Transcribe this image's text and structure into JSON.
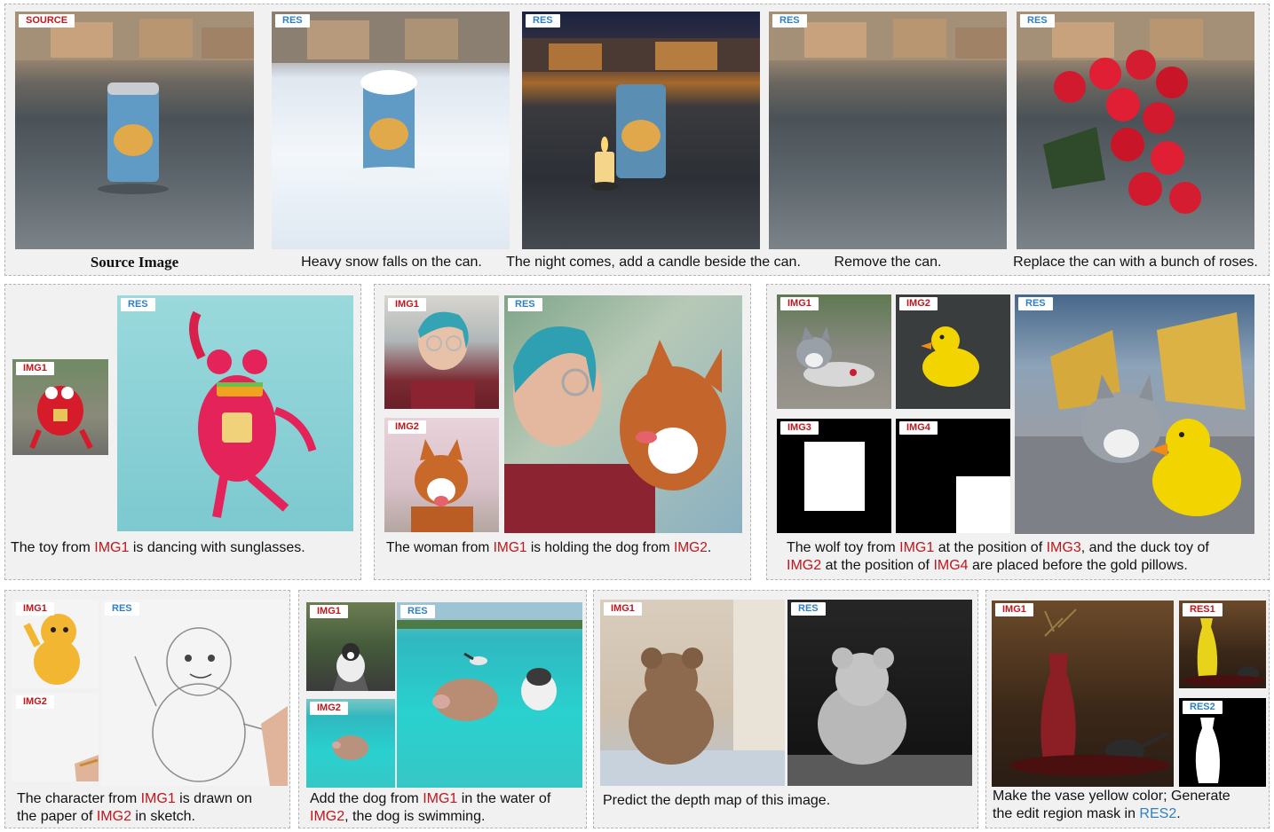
{
  "tags": {
    "source": "SOURCE",
    "res": "RES",
    "res1": "RES1",
    "res2": "RES2",
    "img1": "IMG1",
    "img2": "IMG2",
    "img3": "IMG3",
    "img4": "IMG4"
  },
  "row1": {
    "source_caption": "Source Image",
    "captions": [
      "Heavy snow falls on the can.",
      "The night comes, add a candle beside the can.",
      "Remove the can.",
      "Replace the can with a bunch of roses."
    ]
  },
  "row2": {
    "toy": {
      "pre": "The toy from ",
      "ref1": "IMG1",
      "post": " is dancing with sunglasses."
    },
    "woman": {
      "pre": "The woman from ",
      "ref1": "IMG1",
      "mid": " is holding the dog from ",
      "ref2": "IMG2",
      "post": "."
    },
    "wolf": {
      "l1_pre": "The wolf toy from ",
      "l1_ref1": "IMG1",
      "l1_mid": " at the position of ",
      "l1_ref2": "IMG3",
      "l1_post": ", and the duck toy of",
      "l2_ref1": "IMG2",
      "l2_mid": " at the position of ",
      "l2_ref2": "IMG4",
      "l2_post": " are placed before the gold pillows."
    }
  },
  "row3": {
    "sketch": {
      "l1_pre": "The character from ",
      "l1_ref": "IMG1",
      "l1_post": " is drawn on",
      "l2_pre": "the paper of ",
      "l2_ref": "IMG2",
      "l2_post": " in sketch."
    },
    "swim": {
      "l1_pre": "Add the dog from ",
      "l1_ref": "IMG1",
      "l1_post": " in the water of",
      "l2_ref": "IMG2",
      "l2_post": ", the dog is swimming."
    },
    "depth": {
      "text": "Predict the depth map of this image."
    },
    "vase": {
      "l1": "Make the vase yellow color; Generate",
      "l2_pre": "the edit region mask in ",
      "l2_ref": "RES2",
      "l2_post": "."
    }
  },
  "colors": {
    "ref_red": "#c0161c",
    "ref_blue": "#2f7fc1",
    "panel_bg": "#f1f1f1",
    "panel_border": "#b4b4b4"
  }
}
